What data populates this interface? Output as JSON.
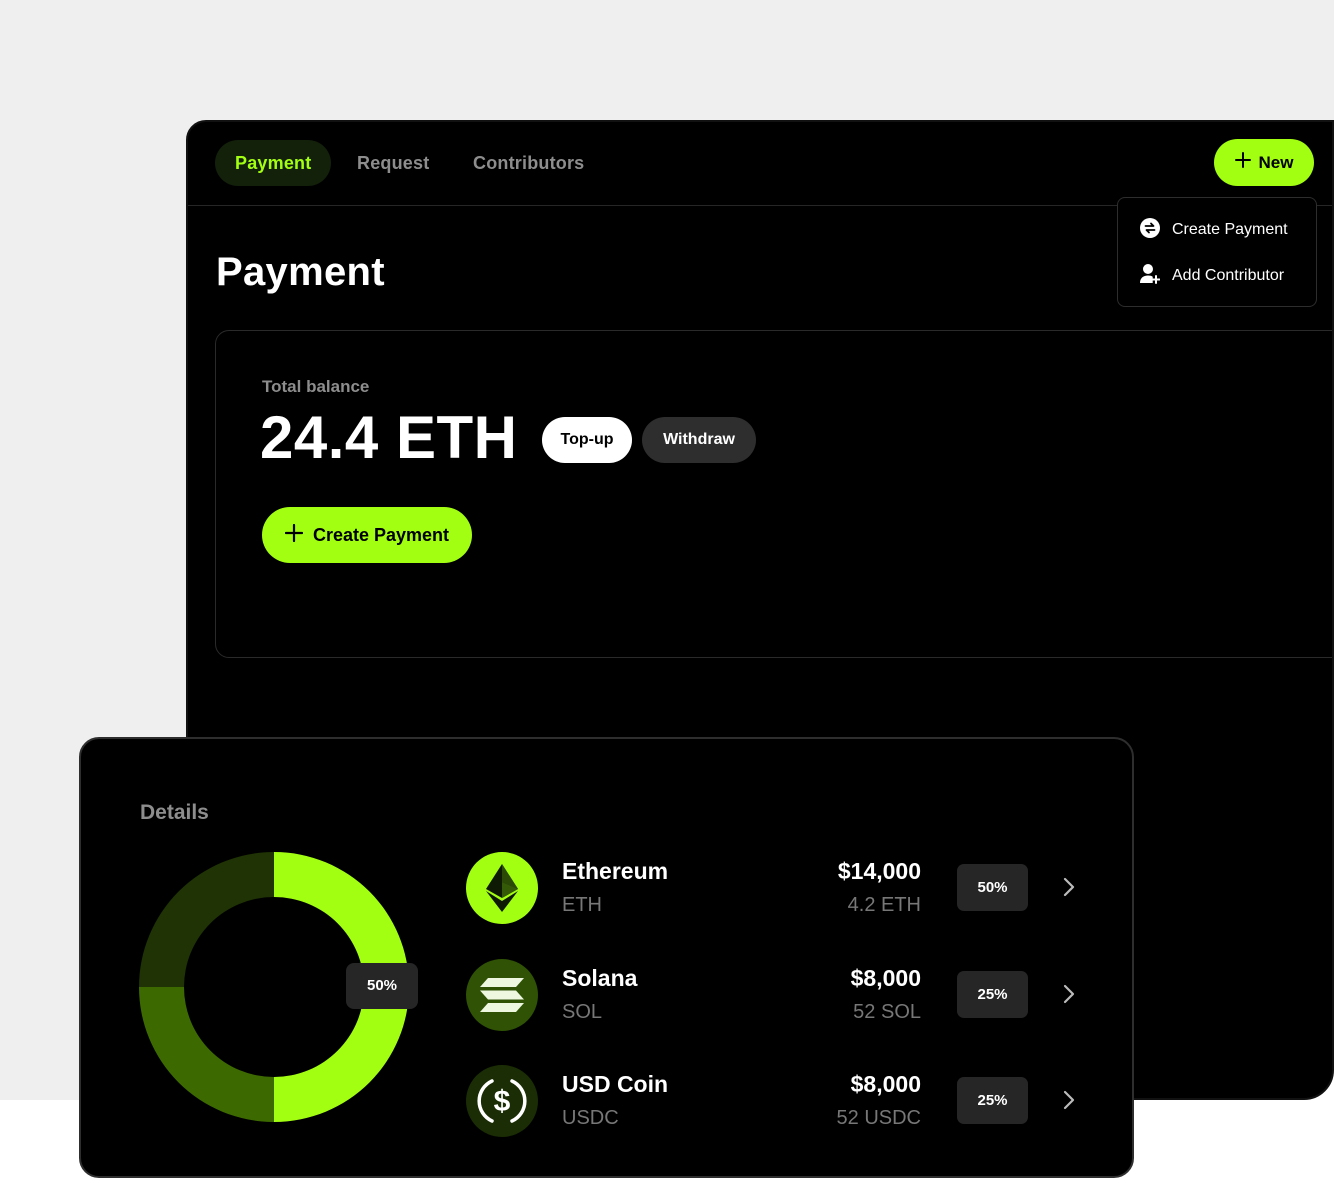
{
  "nav": {
    "tabs": [
      {
        "label": "Payment",
        "active": true
      },
      {
        "label": "Request",
        "active": false
      },
      {
        "label": "Contributors",
        "active": false
      }
    ],
    "new_button": {
      "label": "New",
      "icon": "plus-icon"
    }
  },
  "dropdown": {
    "items": [
      {
        "label": "Create Payment",
        "icon": "swap-circle-icon"
      },
      {
        "label": "Add Contributor",
        "icon": "user-plus-icon"
      }
    ]
  },
  "page": {
    "title": "Payment"
  },
  "balance": {
    "label": "Total balance",
    "value": "24.4 ETH",
    "topup_label": "Top-up",
    "withdraw_label": "Withdraw",
    "create_label": "Create Payment"
  },
  "details": {
    "title": "Details",
    "donut_badge": "50%",
    "assets": [
      {
        "name": "Ethereum",
        "symbol": "ETH",
        "usd": "$14,000",
        "amount": "4.2 ETH",
        "pct": "50%",
        "icon": "ethereum-icon"
      },
      {
        "name": "Solana",
        "symbol": "SOL",
        "usd": "$8,000",
        "amount": "52 SOL",
        "pct": "25%",
        "icon": "solana-icon"
      },
      {
        "name": "USD Coin",
        "symbol": "USDC",
        "usd": "$8,000",
        "amount": "52 USDC",
        "pct": "25%",
        "icon": "usdc-icon"
      }
    ]
  },
  "colors": {
    "accent": "#a3ff12",
    "mid_green": "#3d6a00",
    "dark_green": "#1f3305",
    "background": "#000000",
    "muted_text": "#8d8d8d"
  }
}
